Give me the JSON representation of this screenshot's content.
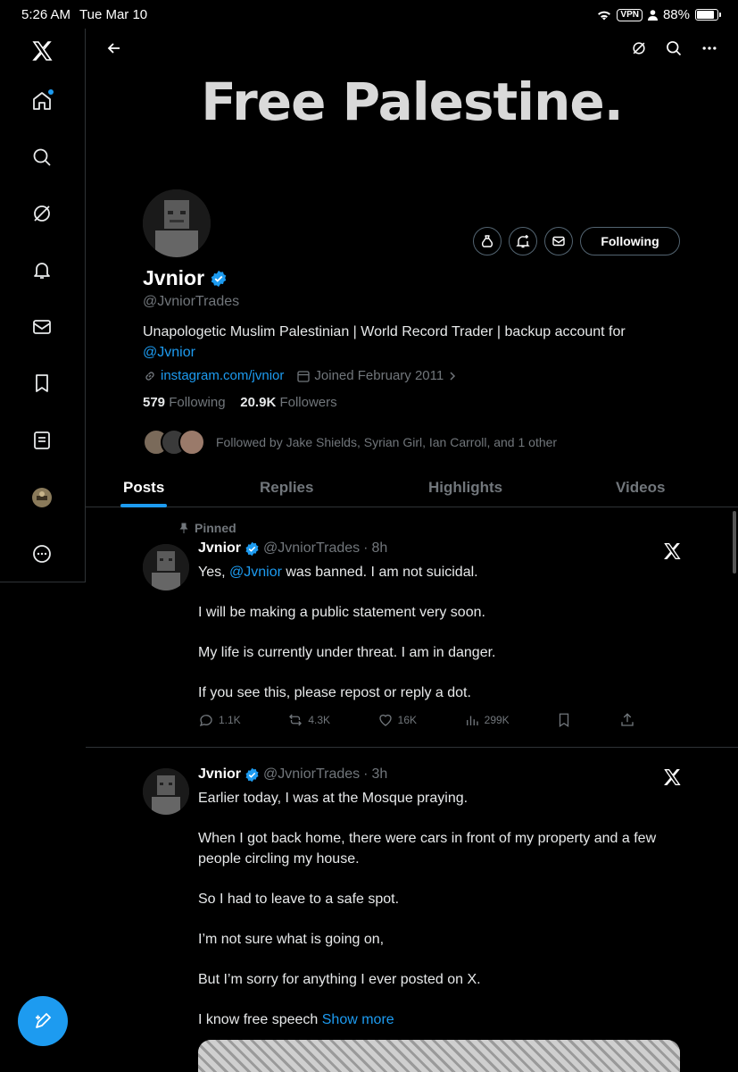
{
  "status_bar": {
    "time": "5:26 AM",
    "date": "Tue Mar 10",
    "vpn": "VPN",
    "battery": "88%"
  },
  "banner": {
    "text": "Free Palestine."
  },
  "profile": {
    "name": "Jvnior",
    "handle": "@JvniorTrades",
    "bio_text": "Unapologetic Muslim Palestinian | World Record Trader | backup account for ",
    "bio_mention": "@Jvnior",
    "website": "instagram.com/jvnior",
    "joined": "Joined February 2011",
    "following_count": "579",
    "following_label": "Following",
    "followers_count": "20.9K",
    "followers_label": "Followers",
    "followed_by": "Followed by Jake Shields, Syrian Girl, Ian Carroll, and 1 other",
    "follow_button": "Following"
  },
  "tabs": [
    {
      "label": "Posts",
      "active": true
    },
    {
      "label": "Replies"
    },
    {
      "label": "Highlights"
    },
    {
      "label": "Videos"
    }
  ],
  "posts": [
    {
      "pinned_label": "Pinned",
      "name": "Jvnior",
      "handle": "@JvniorTrades",
      "time": "8h",
      "line1_pre": "Yes, ",
      "line1_mention": "@Jvnior",
      "line1_post": " was banned. I am not suicidal.",
      "para2": "I will be making a public statement very soon.",
      "para3": "My life is currently under threat. I am in danger.",
      "para4": "If you see this, please repost or reply a dot.",
      "replies": "1.1K",
      "reposts": "4.3K",
      "likes": "16K",
      "views": "299K"
    },
    {
      "name": "Jvnior",
      "handle": "@JvniorTrades",
      "time": "3h",
      "para1": "Earlier today, I was at the Mosque praying.",
      "para2": "When I got back home, there were cars in front of my property and a few people circling my house.",
      "para3": "So I had to leave to a safe spot.",
      "para4": "I’m not sure what is going on,",
      "para5": "But I’m sorry for anything I ever posted on X.",
      "para6": "I know free speech",
      "show_more": "Show more"
    }
  ],
  "colors": {
    "accent": "#1d9bf0",
    "background": "#000000",
    "muted": "#71767b"
  }
}
